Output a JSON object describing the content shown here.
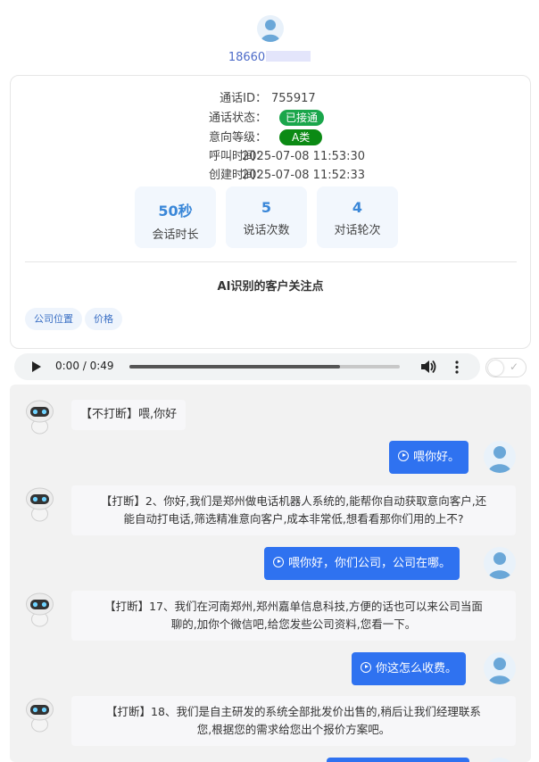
{
  "header": {
    "phone_prefix": "18660"
  },
  "info": {
    "call_id_label": "通话ID：",
    "call_id": "755917",
    "status_label": "通话状态：",
    "status": "已接通",
    "intent_label": "意向等级：",
    "intent": "A类",
    "call_time_label": "呼叫时间：",
    "call_time": "2025-07-08 11:53:30",
    "create_time_label": "创建时间：",
    "create_time": "2025-07-08 11:52:33"
  },
  "stats": [
    {
      "value": "50秒",
      "label": "会话时长"
    },
    {
      "value": "5",
      "label": "说话次数"
    },
    {
      "value": "4",
      "label": "对话轮次"
    }
  ],
  "ai_focus": {
    "title": "AI识别的客户关注点",
    "tags": [
      "公司位置",
      "价格"
    ]
  },
  "audio": {
    "time": "0:00 / 0:49",
    "progress": 0.78
  },
  "messages": [
    {
      "from": "bot",
      "text": "【不打断】喂,你好"
    },
    {
      "from": "user",
      "text": "喂你好。"
    },
    {
      "from": "bot",
      "line1": "【打断】2、你好,我们是郑州做电话机器人系统的,能帮你自动获取意向客户,还",
      "line2": "能自动打电话,筛选精准意向客户,成本非常低,想看看那你们用的上不?"
    },
    {
      "from": "user",
      "text": "喂你好，你们公司，公司在哪。"
    },
    {
      "from": "bot",
      "line1": "【打断】17、我们在河南郑州,郑州嘉单信息科技,方便的话也可以来公司当面",
      "line2": "聊的,加你个微信吧,给您发些公司资料,您看一下。"
    },
    {
      "from": "user",
      "text": "你这怎么收费。"
    },
    {
      "from": "bot",
      "line1": "【打断】18、我们是自主研发的系统全部批发价出售的,稍后让我们经理联系",
      "line2": "您,根据您的需求给您出个报价方案吧。"
    }
  ],
  "colors": {
    "accent": "#2f72f0",
    "stat_number": "#3a87d8",
    "status_badge": "#1aa64b",
    "intent_badge": "#0b8a14"
  }
}
